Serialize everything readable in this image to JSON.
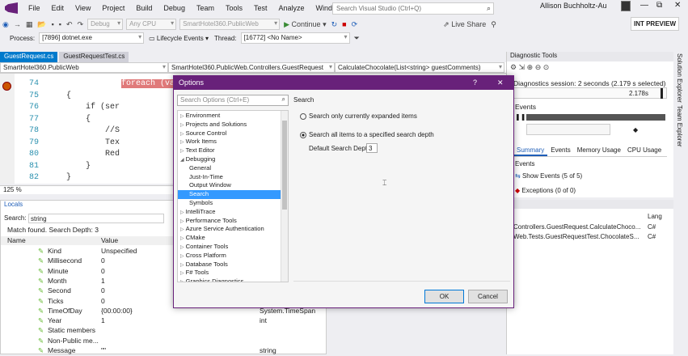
{
  "menu": {
    "items": [
      "File",
      "Edit",
      "View",
      "Project",
      "Build",
      "Debug",
      "Team",
      "Tools",
      "Test",
      "Analyze",
      "Window",
      "Help"
    ]
  },
  "search": {
    "placeholder": "Search Visual Studio (Ctrl+Q)"
  },
  "account": {
    "name": "Allison Buchholtz-Au"
  },
  "toolbar": {
    "config": "Debug",
    "platform": "Any CPU",
    "startup": "SmartHotel360.PublicWeb",
    "continue": "Continue",
    "live_share": "Live Share",
    "int_preview": "INT PREVIEW"
  },
  "procbar": {
    "process_label": "Process:",
    "process": "[7896] dotnet.exe",
    "lifecycle": "Lifecycle Events",
    "thread_label": "Thread:",
    "thread": "[16772] <No Name>"
  },
  "tabs": [
    "GuestRequest.cs",
    "GuestRequestTest.cs"
  ],
  "nav": {
    "project": "SmartHotel360.PublicWeb",
    "class": "SmartHotel360.PublicWeb.Controllers.GuestRequest",
    "method": "CalculateChocolate(List<string> guestComments)"
  },
  "editor": {
    "lines": [
      {
        "n": "74",
        "t": "foreach (var"
      },
      {
        "n": "75",
        "t": "{"
      },
      {
        "n": "76",
        "t": "    if (ser"
      },
      {
        "n": "77",
        "t": "    {"
      },
      {
        "n": "78",
        "t": "        //S"
      },
      {
        "n": "79",
        "t": "        Tex"
      },
      {
        "n": "80",
        "t": "        Red"
      },
      {
        "n": "81",
        "t": "    }"
      },
      {
        "n": "82",
        "t": "}"
      }
    ],
    "zoom": "125 %"
  },
  "locals": {
    "title": "Locals",
    "search_label": "Search:",
    "search_value": "string",
    "match": "Match found. Search Depth: 3",
    "col_name": "Name",
    "col_value": "Value",
    "rows": [
      {
        "name": "Kind",
        "value": "Unspecified",
        "type": ""
      },
      {
        "name": "Millisecond",
        "value": "0",
        "type": ""
      },
      {
        "name": "Minute",
        "value": "0",
        "type": ""
      },
      {
        "name": "Month",
        "value": "1",
        "type": ""
      },
      {
        "name": "Second",
        "value": "0",
        "type": ""
      },
      {
        "name": "Ticks",
        "value": "0",
        "type": ""
      },
      {
        "name": "TimeOfDay",
        "value": "{00:00:00}",
        "type": "System.TimeSpan"
      },
      {
        "name": "Year",
        "value": "1",
        "type": "int"
      },
      {
        "name": "Static members",
        "value": "",
        "type": ""
      },
      {
        "name": "Non-Public me...",
        "value": "",
        "type": ""
      },
      {
        "name": "Message",
        "value": "\"\"",
        "type": "string"
      }
    ]
  },
  "diag": {
    "title": "Diagnostic Tools",
    "session": "Diagnostics session: 2 seconds (2.179 s selected)",
    "time": "2.178s",
    "events_label": "Events",
    "tabs": [
      "Summary",
      "Events",
      "Memory Usage",
      "CPU Usage"
    ],
    "events_section": "Events",
    "show_events": "Show Events (5 of 5)",
    "exceptions": "Exceptions (0 of 0)"
  },
  "callstack": {
    "lang_header": "Lang",
    "rows": [
      {
        "name": "Controllers.GuestRequest.CalculateChoco...",
        "lang": "C#"
      },
      {
        "name": "Web.Tests.GuestRequestTest.ChocolateS...",
        "lang": "C#"
      }
    ]
  },
  "side": {
    "solution": "Solution Explorer",
    "team": "Team Explorer"
  },
  "dialog": {
    "title": "Options",
    "help": "?",
    "close": "✕",
    "search_placeholder": "Search Options (Ctrl+E)",
    "section": "Search",
    "radio1": "Search only currently expanded items",
    "radio2": "Search all items to a specified search depth",
    "depth_label": "Default Search Depth:",
    "depth_value": "3",
    "ok": "OK",
    "cancel": "Cancel",
    "tree": [
      {
        "label": "Environment",
        "indent": 0,
        "arrow": "▷",
        "selected": false
      },
      {
        "label": "Projects and Solutions",
        "indent": 0,
        "arrow": "▷",
        "selected": false
      },
      {
        "label": "Source Control",
        "indent": 0,
        "arrow": "▷",
        "selected": false
      },
      {
        "label": "Work Items",
        "indent": 0,
        "arrow": "▷",
        "selected": false
      },
      {
        "label": "Text Editor",
        "indent": 0,
        "arrow": "▷",
        "selected": false
      },
      {
        "label": "Debugging",
        "indent": 0,
        "arrow": "◢",
        "selected": false
      },
      {
        "label": "General",
        "indent": 1,
        "arrow": "",
        "selected": false
      },
      {
        "label": "Just-In-Time",
        "indent": 1,
        "arrow": "",
        "selected": false
      },
      {
        "label": "Output Window",
        "indent": 1,
        "arrow": "",
        "selected": false
      },
      {
        "label": "Search",
        "indent": 1,
        "arrow": "",
        "selected": true
      },
      {
        "label": "Symbols",
        "indent": 1,
        "arrow": "",
        "selected": false
      },
      {
        "label": "IntelliTrace",
        "indent": 0,
        "arrow": "▷",
        "selected": false
      },
      {
        "label": "Performance Tools",
        "indent": 0,
        "arrow": "▷",
        "selected": false
      },
      {
        "label": "Azure Service Authentication",
        "indent": 0,
        "arrow": "▷",
        "selected": false
      },
      {
        "label": "CMake",
        "indent": 0,
        "arrow": "▷",
        "selected": false
      },
      {
        "label": "Container Tools",
        "indent": 0,
        "arrow": "▷",
        "selected": false
      },
      {
        "label": "Cross Platform",
        "indent": 0,
        "arrow": "▷",
        "selected": false
      },
      {
        "label": "Database Tools",
        "indent": 0,
        "arrow": "▷",
        "selected": false
      },
      {
        "label": "F# Tools",
        "indent": 0,
        "arrow": "▷",
        "selected": false
      },
      {
        "label": "Graphics Diagnostics",
        "indent": 0,
        "arrow": "▷",
        "selected": false
      }
    ]
  }
}
